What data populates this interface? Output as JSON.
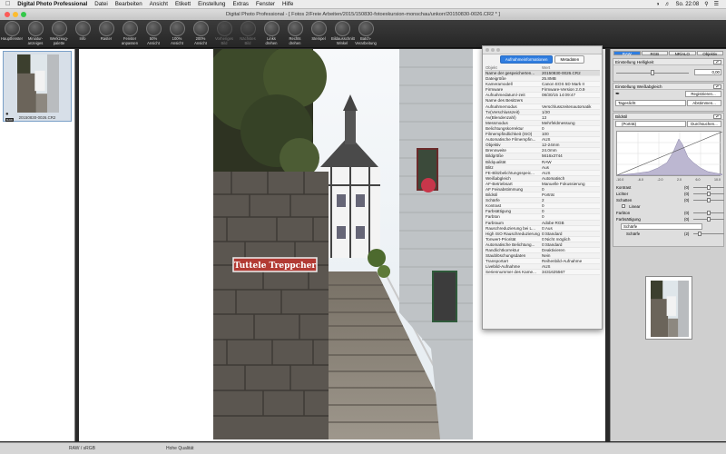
{
  "menubar": {
    "app_name": "Digital Photo Professional",
    "items": [
      "Datei",
      "Bearbeiten",
      "Ansicht",
      "Etikett",
      "Einstellung",
      "Extras",
      "Fenster",
      "Hilfe"
    ],
    "clock": "So. 22:08"
  },
  "window": {
    "title": "Digital Photo Professional - [ Fotos 2/Freie Arbeiten/2015/150830-fotoexkursion-monschau/unkorr/20150830-0026.CR2 * ]"
  },
  "toolbar": [
    {
      "label": "Hauptfenster",
      "icon": "grid-icon",
      "enabled": true
    },
    {
      "label": "Miniatur-\nanzeiges",
      "icon": "thumbnail-icon",
      "enabled": true
    },
    {
      "label": "Werkzeug-\npalette",
      "icon": "palette-icon",
      "enabled": true
    },
    {
      "label": "Info",
      "icon": "info-icon",
      "enabled": true
    },
    {
      "label": "Raster",
      "icon": "grid-lines-icon",
      "enabled": true
    },
    {
      "label": "Fenster\nanpassen",
      "icon": "fit-window-icon",
      "enabled": true
    },
    {
      "label": "50%\nAnsicht",
      "icon": "zoom-50-icon",
      "enabled": true
    },
    {
      "label": "100%\nAnsicht",
      "icon": "zoom-100-icon",
      "enabled": true
    },
    {
      "label": "200%\nAnsicht",
      "icon": "zoom-200-icon",
      "enabled": true
    },
    {
      "label": "Vorheriges\nBild",
      "icon": "previous-icon",
      "enabled": false
    },
    {
      "label": "Nächstes\nBild",
      "icon": "next-icon",
      "enabled": false
    },
    {
      "label": "Links\ndrehen",
      "icon": "rotate-left-icon",
      "enabled": true
    },
    {
      "label": "Rechts\ndrehen",
      "icon": "rotate-right-icon",
      "enabled": true
    },
    {
      "label": "Stempel",
      "icon": "stamp-icon",
      "enabled": true
    },
    {
      "label": "Bildausschnitt\nWinkel",
      "icon": "crop-icon",
      "enabled": true
    },
    {
      "label": "Batch-\nVerarbeitung",
      "icon": "batch-icon",
      "enabled": true
    }
  ],
  "thumbnail": {
    "caption": "20150830-0026.CR2"
  },
  "photo": {
    "sign_text": "Tuttele Treppcher"
  },
  "info_window": {
    "tabs": [
      "Aufnahmeinformationen",
      "Metadaten"
    ],
    "active_tab": 0,
    "col_object": "Objekt",
    "col_value": "Wert",
    "rows": [
      [
        "Name der gespeicherten...",
        "20150830-0026.CR2"
      ],
      [
        "Dateigröße",
        "25.8MB"
      ],
      [
        "Kameramodell",
        "Canon EOS 5D Mark II"
      ],
      [
        "Firmware",
        "Firmware-Version 2.0.9"
      ],
      [
        "Aufnahmedatum/-zeit",
        "08/30/15 14:09:47"
      ],
      [
        "Name des Besitzers",
        ""
      ],
      [
        "Aufnahmemodus",
        "Verschlusszeitenautomatik"
      ],
      [
        "Tv(Verschlusszeit)",
        "1/20"
      ],
      [
        "Av(Blendenzahl)",
        "13"
      ],
      [
        "Messmodus",
        "Mehrfeldmessung"
      ],
      [
        "Belichtungskorrektur",
        "0"
      ],
      [
        "Filmempfindlichkeit (ISO)",
        "100"
      ],
      [
        "Automatische Filmempfin...",
        "AUS"
      ],
      [
        "Objektiv",
        "12-24mm"
      ],
      [
        "Brennweite",
        "24.0mm"
      ],
      [
        "Bildgröße",
        "5616x3744"
      ],
      [
        "Bildqualität",
        "RAW"
      ],
      [
        "Blitz",
        "Aus"
      ],
      [
        "FE-Blitzbelichtungsspeic...",
        "AUS"
      ],
      [
        "Weißabgleich",
        "Automatisch"
      ],
      [
        "AF-Betriebsart",
        "Manuelle Fokussierung"
      ],
      [
        "AF Feinabstimmung",
        "0"
      ],
      [
        "Bildstil",
        "Porträt"
      ],
      [
        "Schärfe",
        "2"
      ],
      [
        "Kontrast",
        "0"
      ],
      [
        "Farbsättigung",
        "0"
      ],
      [
        "Farbton",
        "0"
      ],
      [
        "Farbraum",
        "Adobe RGB"
      ],
      [
        "Rauschreduzierung bei L...",
        "0:Aus"
      ],
      [
        "High ISO Rauschreduzierung",
        "0:Standard"
      ],
      [
        "Tonwert-Priorität",
        "0:Nicht möglich"
      ],
      [
        "Automatische Belichtung...",
        "0:Standard"
      ],
      [
        "Randlichtkorrektur",
        "Deaktivieren"
      ],
      [
        "Staublöschungsdaten",
        "Nein"
      ],
      [
        "Transportart",
        "Reihenbild-Aufnahme"
      ],
      [
        "Livebild-Aufnahme",
        "AUS"
      ],
      [
        "Seriennummer des Kame...",
        "3431625567"
      ]
    ]
  },
  "right_panel": {
    "tabs": [
      "RAW",
      "RGB",
      "NR/ALO",
      "Objektiv"
    ],
    "active_tab": 0,
    "brightness_title": "Einstellung Helligkeit",
    "brightness_value": "0,00",
    "wb_title": "Einstellung Weißabgleich",
    "wb_register": "Registrieren...",
    "wb_mode": "Tageslicht",
    "wb_adjust": "Abstimmen...",
    "picstyle_title": "Bildstil",
    "picstyle_value": "(Porträt)",
    "picstyle_browse": "Durchsuchen...",
    "histogram_labels": [
      "-10.0",
      "-6.0",
      "-2.0",
      "2.0",
      "6.0",
      "10.0"
    ],
    "sliders": [
      {
        "label": "Kontrast",
        "value": "(0)",
        "pos": 0.5
      },
      {
        "label": "Lichter",
        "value": "(0)",
        "pos": 0.5
      },
      {
        "label": "Schatten",
        "value": "(0)",
        "pos": 0.5
      }
    ],
    "linear_label": "Linear",
    "sliders2": [
      {
        "label": "Farbton",
        "value": "(0)",
        "pos": 0.5
      },
      {
        "label": "Farbsättigung",
        "value": "(0)",
        "pos": 0.5
      }
    ],
    "sharpness_mode": "Schärfe",
    "sharpness_label": "Schärfe",
    "sharpness_value": "(2)",
    "sharpness_pos": 0.2
  },
  "statusbar": {
    "left": "RAW / sRGB",
    "right": "Hohe Qualität"
  },
  "colors": {
    "accent": "#2f7de0",
    "toolbar": "#2f2f2f"
  }
}
